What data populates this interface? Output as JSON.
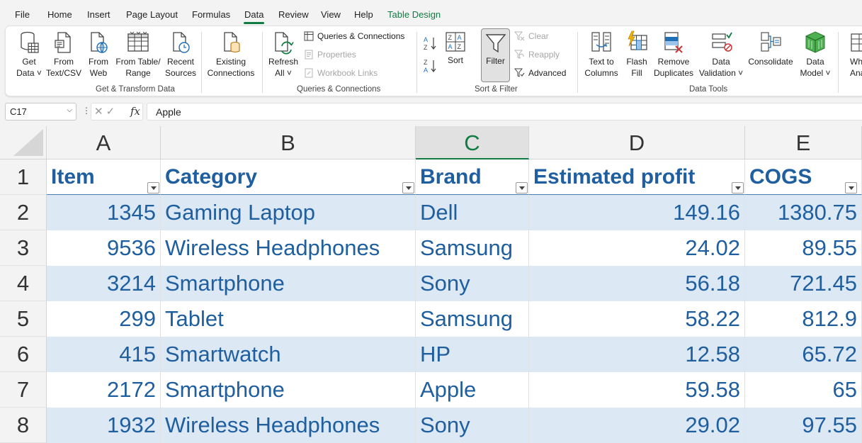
{
  "menu": {
    "tabs": [
      "File",
      "Home",
      "Insert",
      "Page Layout",
      "Formulas",
      "Data",
      "Review",
      "View",
      "Help",
      "Table Design"
    ],
    "active": "Data"
  },
  "ribbon": {
    "get_transform": {
      "get_data": [
        "Get",
        "Data ˅"
      ],
      "from_text_csv": [
        "From",
        "Text/CSV"
      ],
      "from_web": [
        "From",
        "Web"
      ],
      "from_table_range": [
        "From Table/",
        "Range"
      ],
      "recent_sources": [
        "Recent",
        "Sources"
      ],
      "existing_connections": [
        "Existing",
        "Connections"
      ],
      "label": "Get & Transform Data"
    },
    "queries": {
      "refresh_all": [
        "Refresh",
        "All ˅"
      ],
      "queries_connections": "Queries & Connections",
      "properties": "Properties",
      "workbook_links": "Workbook Links",
      "label": "Queries & Connections"
    },
    "sort_filter": {
      "sort": "Sort",
      "filter": "Filter",
      "clear": "Clear",
      "reapply": "Reapply",
      "advanced": "Advanced",
      "label": "Sort & Filter"
    },
    "data_tools": {
      "text_to_columns": [
        "Text to",
        "Columns"
      ],
      "flash_fill": [
        "Flash",
        "Fill"
      ],
      "remove_duplicates": [
        "Remove",
        "Duplicates"
      ],
      "data_validation": [
        "Data",
        "Validation ˅"
      ],
      "consolidate": "Consolidate",
      "data_model": [
        "Data",
        "Model ˅"
      ],
      "what_if": [
        "Wh",
        "Anal"
      ],
      "label": "Data Tools"
    },
    "colors": {
      "accent": "#107c41",
      "icon_blue": "#1f6fb5"
    }
  },
  "formula_bar": {
    "name_box": "C17",
    "formula": "Apple"
  },
  "sheet": {
    "columns": [
      "A",
      "B",
      "C",
      "D",
      "E"
    ],
    "selected_column": "C",
    "rows": [
      "1",
      "2",
      "3",
      "4",
      "5",
      "6",
      "7",
      "8"
    ],
    "headers": [
      "Item",
      "Category",
      "Brand",
      "Estimated profit",
      "COGS"
    ],
    "data": [
      [
        "1345",
        "Gaming Laptop",
        "Dell",
        "149.16",
        "1380.75"
      ],
      [
        "9536",
        "Wireless Headphones",
        "Samsung",
        "24.02",
        "89.55"
      ],
      [
        "3214",
        "Smartphone",
        "Sony",
        "56.18",
        "721.45"
      ],
      [
        "299",
        "Tablet",
        "Samsung",
        "58.22",
        "812.9"
      ],
      [
        "415",
        "Smartwatch",
        "HP",
        "12.58",
        "65.72"
      ],
      [
        "2172",
        "Smartphone",
        "Apple",
        "59.58",
        "65"
      ],
      [
        "1932",
        "Wireless Headphones",
        "Sony",
        "29.02",
        "97.55"
      ]
    ],
    "colors": {
      "text": "#1f5fa0",
      "band": "#dce8f4"
    }
  }
}
